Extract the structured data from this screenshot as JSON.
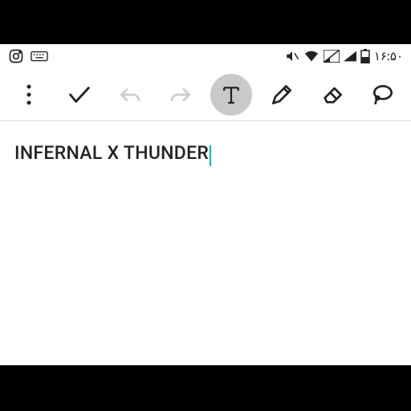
{
  "status": {
    "time": "۱۶:۵۰"
  },
  "note": {
    "text": "INFERNAL X THUNDER"
  }
}
